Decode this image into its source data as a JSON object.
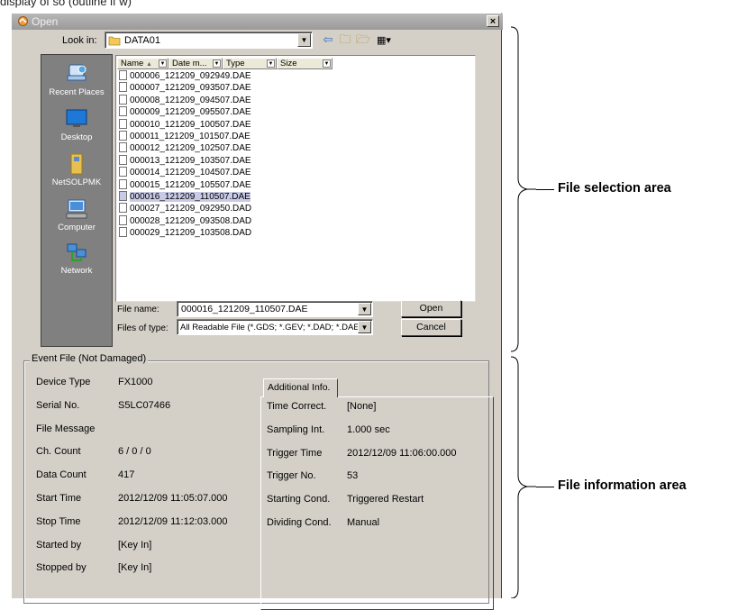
{
  "cut_text": "display of so (outline if w)",
  "dialog": {
    "title": "Open",
    "close_label": "×",
    "look_in_label": "Look in:",
    "look_in_value": "DATA01",
    "places": [
      {
        "label": "Recent Places",
        "icon": "recent-places-icon"
      },
      {
        "label": "Desktop",
        "icon": "desktop-icon"
      },
      {
        "label": "NetSOLPMK",
        "icon": "user-folder-icon"
      },
      {
        "label": "Computer",
        "icon": "computer-icon"
      },
      {
        "label": "Network",
        "icon": "network-icon"
      }
    ],
    "columns": [
      "Name",
      "Date m...",
      "Type",
      "Size"
    ],
    "files": [
      "000006_121209_092949.DAE",
      "000007_121209_093507.DAE",
      "000008_121209_094507.DAE",
      "000009_121209_095507.DAE",
      "000010_121209_100507.DAE",
      "000011_121209_101507.DAE",
      "000012_121209_102507.DAE",
      "000013_121209_103507.DAE",
      "000014_121209_104507.DAE",
      "000015_121209_105507.DAE",
      "000016_121209_110507.DAE",
      "000027_121209_092950.DAD",
      "000028_121209_093508.DAD",
      "000029_121209_103508.DAD"
    ],
    "selected_file_index": 10,
    "file_name_label": "File name:",
    "file_name_value": "000016_121209_110507.DAE",
    "files_of_type_label": "Files of type:",
    "files_of_type_value": "All Readable File (*.GDS; *.GEV; *.DAD; *.DAE;",
    "open_button": "Open",
    "cancel_button": "Cancel"
  },
  "event_file": {
    "legend": "Event File (Not Damaged)",
    "fields": [
      {
        "label": "Device Type",
        "value": "FX1000"
      },
      {
        "label": "Serial No.",
        "value": "S5LC07466"
      },
      {
        "label": "File Message",
        "value": ""
      },
      {
        "label": "Ch. Count",
        "value": "6 / 0 / 0"
      },
      {
        "label": "Data Count",
        "value": "417"
      },
      {
        "label": "Start Time",
        "value": "2012/12/09 11:05:07.000"
      },
      {
        "label": "Stop Time",
        "value": "2012/12/09 11:12:03.000"
      },
      {
        "label": "Started by",
        "value": "[Key In]"
      },
      {
        "label": "Stopped by",
        "value": "[Key In]"
      }
    ],
    "tab_label": "Additional Info.",
    "additional": [
      {
        "label": "Time Correct.",
        "value": "[None]"
      },
      {
        "label": "Sampling Int.",
        "value": "1.000 sec"
      },
      {
        "label": "Trigger Time",
        "value": "2012/12/09 11:06:00.000"
      },
      {
        "label": "Trigger No.",
        "value": "53"
      },
      {
        "label": "Starting Cond.",
        "value": "Triggered Restart"
      },
      {
        "label": "Dividing Cond.",
        "value": "Manual"
      }
    ]
  },
  "annotations": {
    "file_selection": "File selection area",
    "file_information": "File information area"
  },
  "colors": {
    "dialog_bg": "#d4d0c8",
    "places_bg": "#808080",
    "selection": "#c9cbe6"
  }
}
